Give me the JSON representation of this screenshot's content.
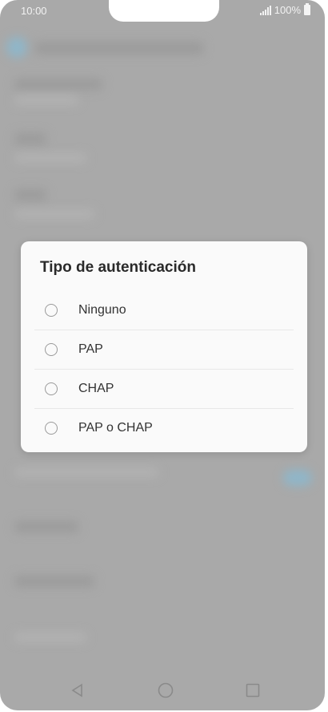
{
  "status_bar": {
    "time": "10:00",
    "battery": "100%",
    "signal_icon": "signal-icon",
    "battery_icon": "battery-icon"
  },
  "dialog": {
    "title": "Tipo de autenticación",
    "options": [
      {
        "label": "Ninguno",
        "selected": false
      },
      {
        "label": "PAP",
        "selected": false
      },
      {
        "label": "CHAP",
        "selected": false
      },
      {
        "label": "PAP o CHAP",
        "selected": false
      }
    ]
  },
  "nav_bar": {
    "back_icon": "back-triangle-icon",
    "home_icon": "home-circle-icon",
    "recents_icon": "recents-square-icon"
  },
  "colors": {
    "overlay": "#a9a9a9",
    "dialog_bg": "#fafafa",
    "text": "#333333"
  }
}
